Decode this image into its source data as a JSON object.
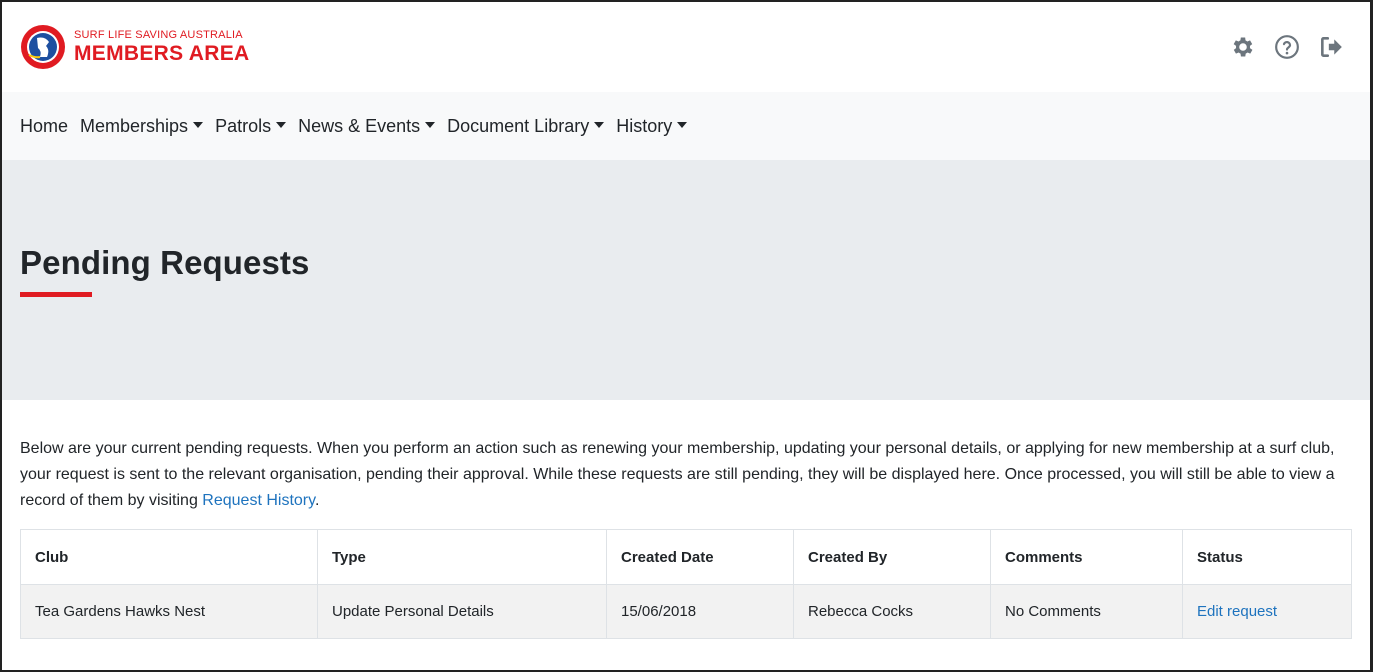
{
  "brand": {
    "subtitle": "SURF LIFE SAVING AUSTRALIA",
    "title": "MEMBERS AREA",
    "accent_color": "#e01b22"
  },
  "header_icons": [
    "gear-icon",
    "help-icon",
    "logout-icon"
  ],
  "nav": {
    "items": [
      {
        "label": "Home",
        "dropdown": false
      },
      {
        "label": "Memberships",
        "dropdown": true
      },
      {
        "label": "Patrols",
        "dropdown": true
      },
      {
        "label": "News & Events",
        "dropdown": true
      },
      {
        "label": "Document Library",
        "dropdown": true
      },
      {
        "label": "History",
        "dropdown": true
      }
    ]
  },
  "page": {
    "title": "Pending Requests",
    "intro_text": "Below are your current pending requests. When you perform an action such as renewing your membership, updating your personal details, or applying for new membership at a surf club, your request is sent to the relevant organisation, pending their approval. While these requests are still pending, they will be displayed here. Once processed, you will still be able to view a record of them by visiting ",
    "intro_link": "Request History",
    "intro_end": "."
  },
  "table": {
    "columns": [
      "Club",
      "Type",
      "Created Date",
      "Created By",
      "Comments",
      "Status"
    ],
    "rows": [
      {
        "club": "Tea Gardens Hawks Nest",
        "type": "Update Personal Details",
        "created_date": "15/06/2018",
        "created_by": "Rebecca Cocks",
        "comments": "No Comments",
        "status": "Edit request"
      }
    ]
  }
}
